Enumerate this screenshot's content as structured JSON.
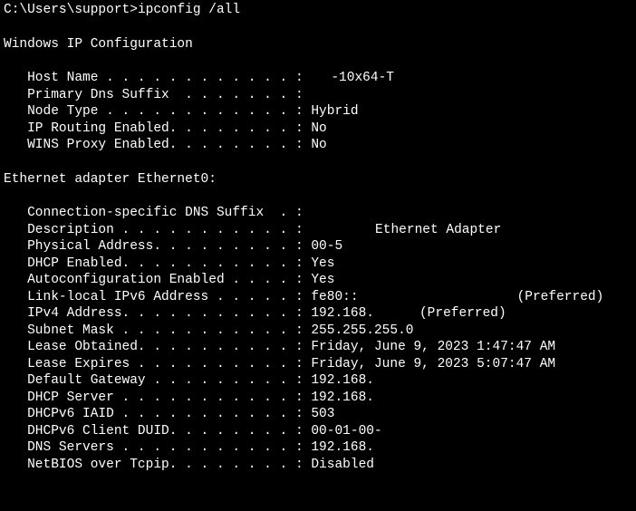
{
  "prompt": "C:\\Users\\support>",
  "command": "ipconfig /all",
  "section1": "Windows IP Configuration",
  "hostname_label": "   Host Name . . . . . . . . . . . . : ",
  "hostname_visible": "-10x64-T",
  "primary_dns": "   Primary Dns Suffix  . . . . . . . :",
  "node_type": "   Node Type . . . . . . . . . . . . : Hybrid",
  "ip_routing": "   IP Routing Enabled. . . . . . . . : No",
  "wins_proxy": "   WINS Proxy Enabled. . . . . . . . : No",
  "section2": "Ethernet adapter Ethernet0:",
  "conn_dns": "   Connection-specific DNS Suffix  . :",
  "description_label": "   Description . . . . . . . . . . . : ",
  "description_suffix": " Ethernet Adapter",
  "phys_addr_label": "   Physical Address. . . . . . . . . : ",
  "phys_addr_visible": "00-5",
  "dhcp_enabled": "   DHCP Enabled. . . . . . . . . . . : Yes",
  "autoconfig": "   Autoconfiguration Enabled . . . . : Yes",
  "ll_ipv6_label": "   Link-local IPv6 Address . . . . . : ",
  "ll_ipv6_visible": "fe80::",
  "ll_ipv6_suffix": "(Preferred)",
  "ipv4_label": "   IPv4 Address. . . . . . . . . . . : ",
  "ipv4_visible": "192.168.",
  "ipv4_suffix": "(Preferred)",
  "subnet": "   Subnet Mask . . . . . . . . . . . : 255.255.255.0",
  "lease_obtained": "   Lease Obtained. . . . . . . . . . : Friday, June 9, 2023 1:47:47 AM",
  "lease_expires": "   Lease Expires . . . . . . . . . . : Friday, June 9, 2023 5:07:47 AM",
  "gateway_label": "   Default Gateway . . . . . . . . . : ",
  "gateway_visible": "192.168.",
  "dhcp_server_label": "   DHCP Server . . . . . . . . . . . : ",
  "dhcp_server_visible": "192.168.",
  "dhcpv6_iaid_label": "   DHCPv6 IAID . . . . . . . . . . . : ",
  "dhcpv6_iaid_visible": "503",
  "dhcpv6_duid_label": "   DHCPv6 Client DUID. . . . . . . . : ",
  "dhcpv6_duid_visible": "00-01-00-",
  "dns_servers_label": "   DNS Servers . . . . . . . . . . . : ",
  "dns_servers_visible": "192.168.",
  "netbios": "   NetBIOS over Tcpip. . . . . . . . : Disabled"
}
